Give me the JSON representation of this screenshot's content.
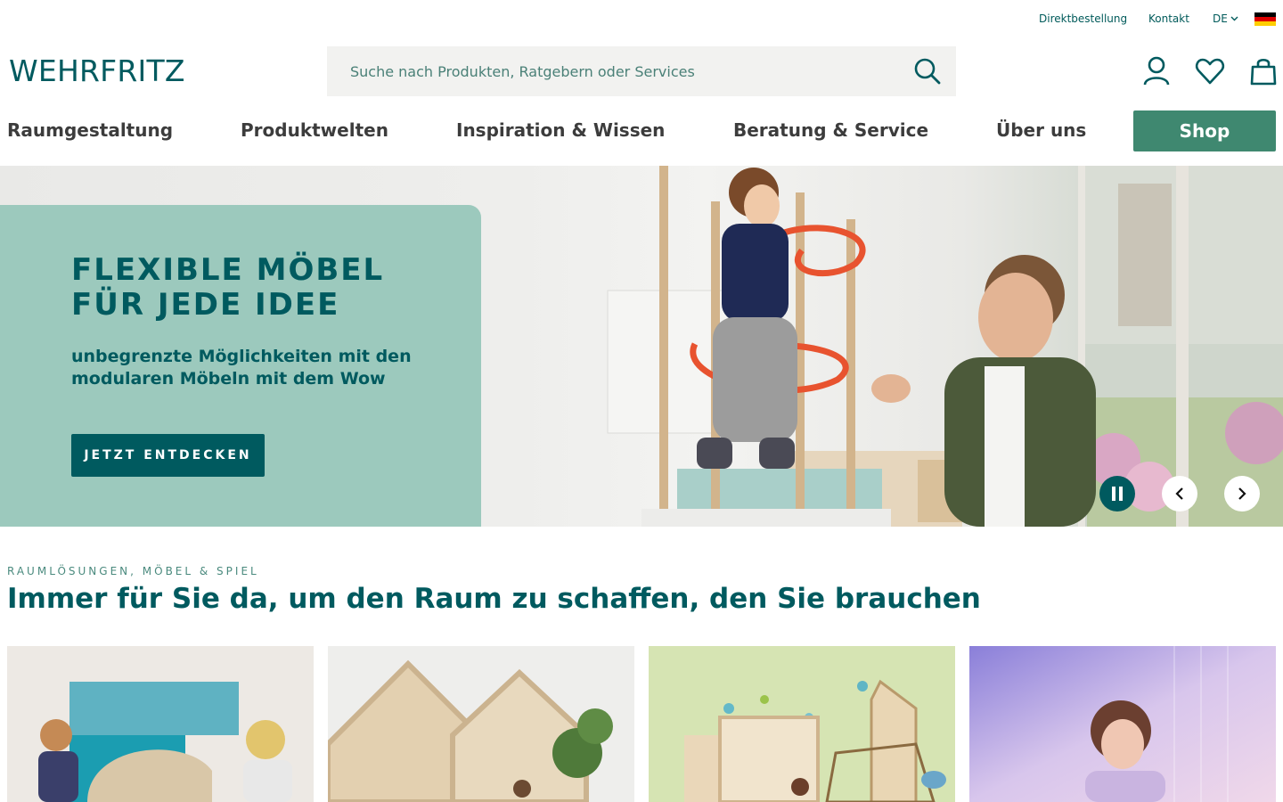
{
  "utility": {
    "direktbestellung": "Direktbestellung",
    "kontakt": "Kontakt",
    "language": "DE",
    "flag_icon": "germany-flag-icon"
  },
  "header": {
    "logo_text": "WEHRFRITZ",
    "search_placeholder": "Suche nach Produkten, Ratgebern oder Services",
    "icons": [
      "search-icon",
      "account-icon",
      "heart-icon",
      "shopping-bag-icon"
    ]
  },
  "nav": {
    "items": [
      "Raumgestaltung",
      "Produktwelten",
      "Inspiration & Wissen",
      "Beratung & Service",
      "Über uns"
    ],
    "shop_label": "Shop"
  },
  "hero": {
    "title": "FLEXIBLE MÖBEL FÜR JEDE IDEE",
    "subtitle": "unbegrenzte Möglichkeiten mit den modularen Möbeln mit dem Wow",
    "cta_label": "JETZT ENTDECKEN",
    "controls": [
      "pause-icon",
      "chevron-left-icon",
      "chevron-right-icon"
    ]
  },
  "section": {
    "eyebrow": "RAUMLÖSUNGEN, MÖBEL & SPIEL",
    "title": "Immer für Sie da, um den Raum zu schaffen, den Sie brauchen"
  },
  "colors": {
    "brand_dark": "#005a5f",
    "brand_green": "#3f8870",
    "hero_panel": "#9cc9bd",
    "search_bg": "#f2f2f0"
  }
}
